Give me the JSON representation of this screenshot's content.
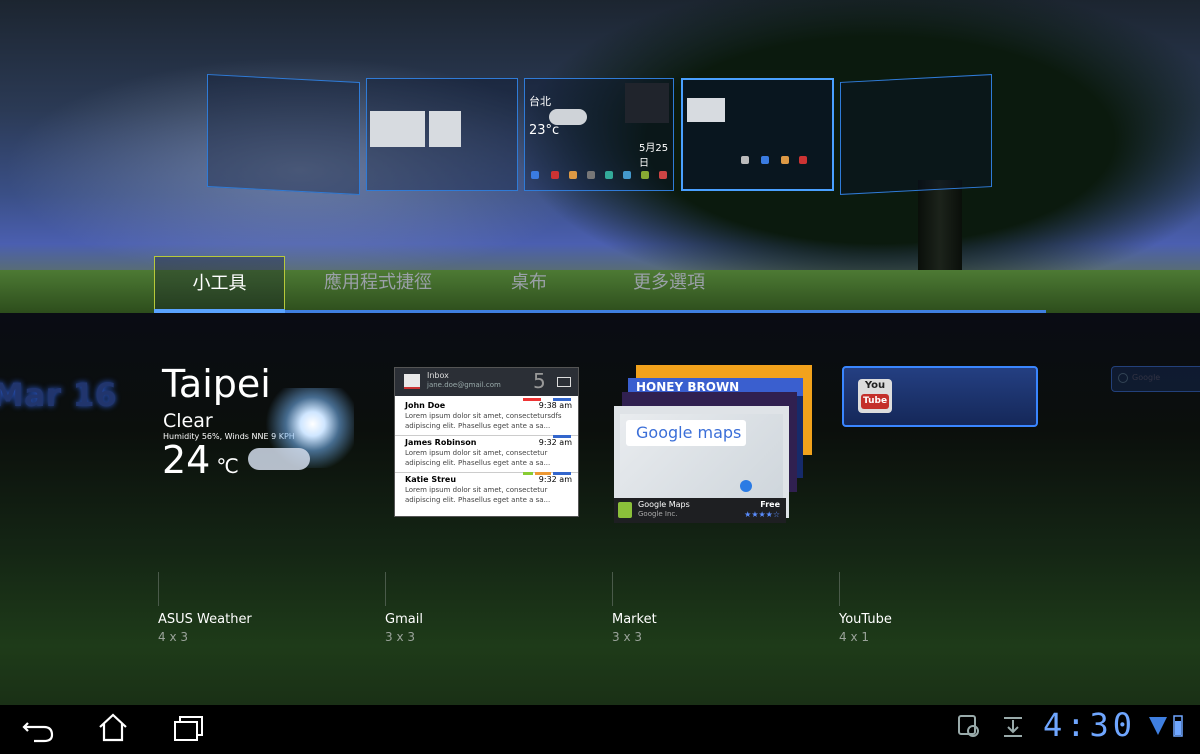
{
  "tabs": [
    {
      "label": "小工具",
      "selected": true
    },
    {
      "label": "應用程式捷徑",
      "selected": false
    },
    {
      "label": "桌布",
      "selected": false
    },
    {
      "label": "更多選項",
      "selected": false
    }
  ],
  "workspace_preview": {
    "city": "台北",
    "temp": "23°c",
    "date": "5月25日"
  },
  "ghost_date": "Mar 16",
  "weather": {
    "city": "Taipei",
    "condition": "Clear",
    "detail": "Humidity 56%, Winds NNE 9 KPH",
    "temp": "24",
    "unit": "℃"
  },
  "gmail": {
    "inbox_label": "Inbox",
    "account": "jane.doe@gmail.com",
    "count": "5",
    "messages": [
      {
        "from": "John Doe",
        "time": "9:38 am",
        "body": "Lorem ipsum dolor sit amet, consectetursdfs adipiscing elit. Phasellus eget ante a sa..."
      },
      {
        "from": "James Robinson",
        "time": "9:32 am",
        "body": "Lorem ipsum dolor sit amet, consectetur adipiscing elit. Phasellus eget ante a sa..."
      },
      {
        "from": "Katie Streu",
        "time": "9:32 am",
        "body": "Lorem ipsum dolor sit amet, consectetur adipiscing elit. Phasellus eget ante a sa..."
      }
    ]
  },
  "market": {
    "banner_text": "HONEY BROWN",
    "map_title": "Google maps",
    "app_name": "Google Maps",
    "developer": "Google Inc.",
    "price": "Free",
    "rating_stars": "★★★★☆"
  },
  "youtube": {
    "logo_top": "You",
    "logo_bottom": "Tube"
  },
  "google_search": {
    "placeholder": "Google"
  },
  "widgets": [
    {
      "name": "ASUS Weather",
      "size": "4 x 3"
    },
    {
      "name": "Gmail",
      "size": "3 x 3"
    },
    {
      "name": "Market",
      "size": "3 x 3"
    },
    {
      "name": "YouTube",
      "size": "4 x 1"
    }
  ],
  "status": {
    "clock": "4:30"
  },
  "colors": {
    "accent": "#3f7fe0",
    "tab_selected_border": "#b7c93a",
    "clock": "#6fa6ff"
  }
}
